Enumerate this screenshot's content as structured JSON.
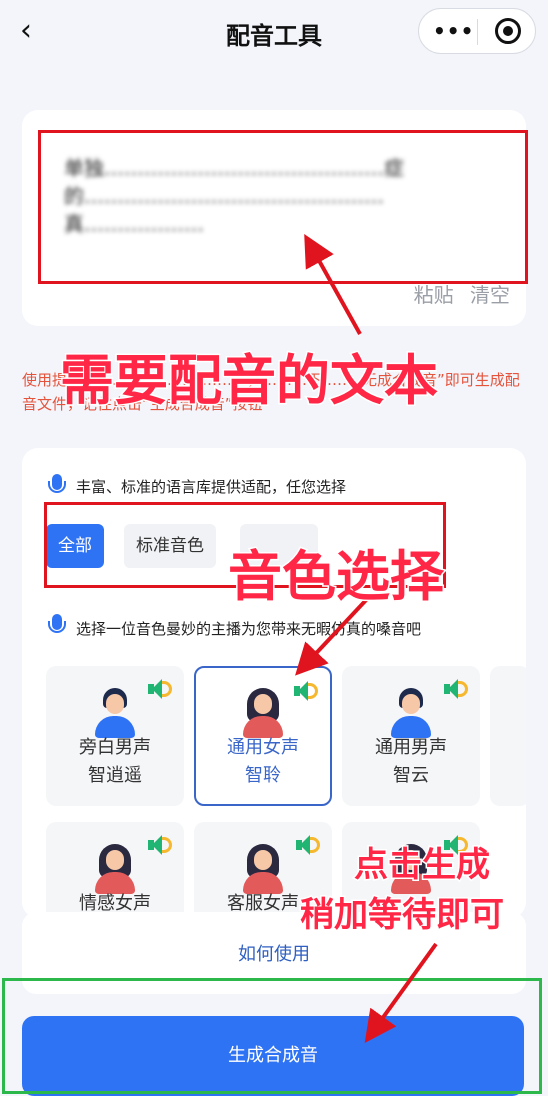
{
  "nav": {
    "title": "配音工具",
    "back_icon": "chevron-left-icon",
    "more_icon": "more-dots-icon",
    "close_icon": "target-icon"
  },
  "text_input": {
    "content": "单独……………………………………症的………………………………………真………………",
    "paste_label": "粘贴",
    "clear_label": "清空"
  },
  "notice": "使用提………………………………，………下……‥无成合成音”即可生成配音文件，记住点击“生成合成音”按钮",
  "voice_section": {
    "hint1": "丰富、标准的语言库提供适配，任您选择",
    "categories": [
      {
        "label": "全部",
        "active": true
      },
      {
        "label": "标准音色",
        "active": false
      },
      {
        "label": "",
        "active": false
      }
    ],
    "hint2": "选择一位音色曼妙的主播为您带来无暇仿真的嗓音吧",
    "voices": [
      {
        "line1": "旁白男声",
        "line2": "智逍遥",
        "gender": "male",
        "selected": false
      },
      {
        "line1": "通用女声",
        "line2": "智聆",
        "gender": "female",
        "selected": true
      },
      {
        "line1": "通用男声",
        "line2": "智云",
        "gender": "male",
        "selected": false
      },
      {
        "line1": "情感女声",
        "line2": "",
        "gender": "female",
        "selected": false
      },
      {
        "line1": "客服女声",
        "line2": "",
        "gender": "female",
        "selected": false
      },
      {
        "line1": "",
        "line2": "",
        "gender": "female",
        "selected": false
      }
    ]
  },
  "how_to_use": "如何使用",
  "generate_button": "生成合成音",
  "annotations": {
    "text_label": "需要配音的文本",
    "voice_label": "音色选择",
    "wait_label_line1": "点击生成",
    "wait_label_line2": "稍加等待即可"
  },
  "colors": {
    "accent": "#2f73f5",
    "annotation_red": "#e0141e",
    "annotation_green": "#2db84b",
    "selected_border": "#3a66c9"
  }
}
